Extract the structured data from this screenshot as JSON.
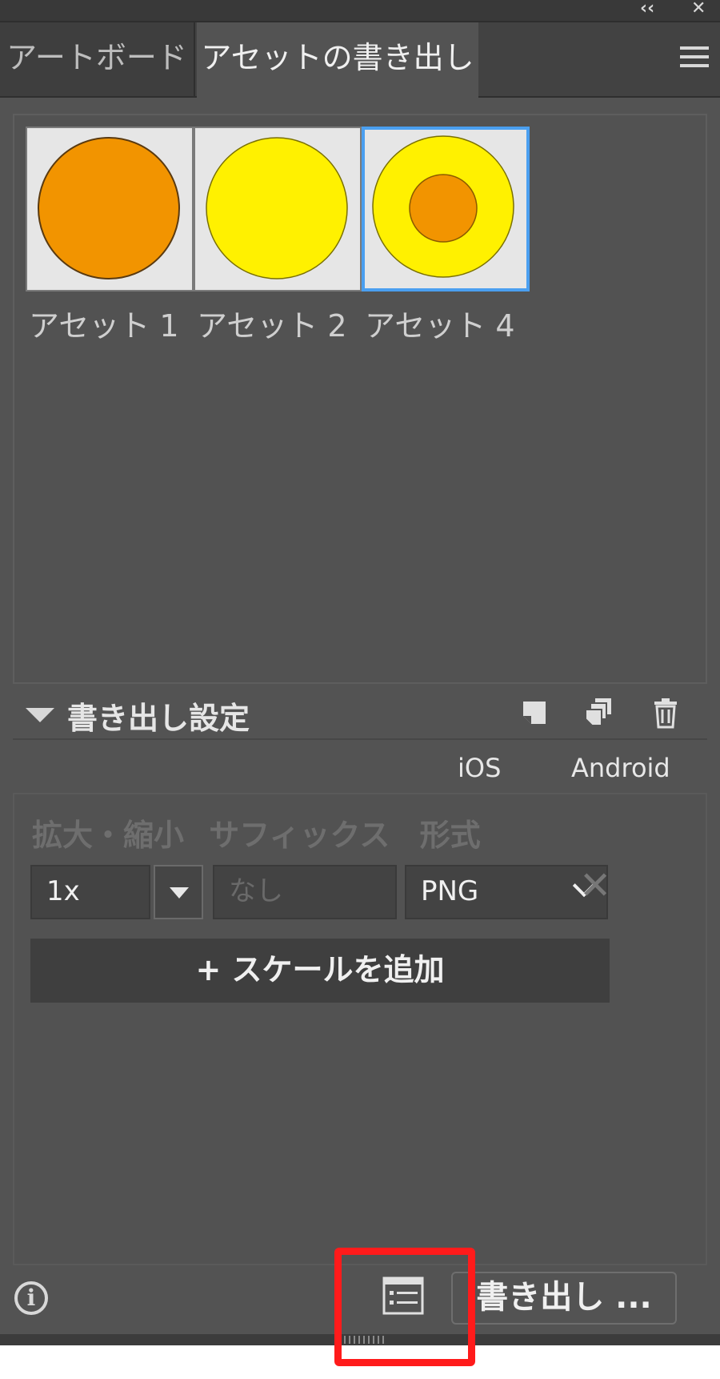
{
  "titlebar": {
    "collapse_glyph": "‹‹",
    "close_glyph": "✕"
  },
  "tabs": [
    {
      "label": "アートボード",
      "active": false
    },
    {
      "label": "アセットの書き出し",
      "active": true
    }
  ],
  "panel_menu_icon": "hamburger-menu-icon",
  "assets": [
    {
      "label": "アセット 1",
      "selected": false,
      "shape": "orange-circle"
    },
    {
      "label": "アセット 2",
      "selected": false,
      "shape": "yellow-circle"
    },
    {
      "label": "アセット 4",
      "selected": true,
      "shape": "yellow-circle-with-orange-center"
    }
  ],
  "export_settings": {
    "title": "書き出し設定",
    "icons": [
      "new-format-icon",
      "duplicate-format-icon",
      "trash-icon"
    ]
  },
  "presets": {
    "ios": "iOS",
    "android": "Android"
  },
  "columns": {
    "scale": "拡大・縮小",
    "suffix": "サフィックス",
    "format": "形式"
  },
  "scale_row": {
    "scale_value": "1x",
    "suffix_placeholder": "なし",
    "format_value": "PNG"
  },
  "add_scale_label": "+ スケールを追加",
  "footer": {
    "info_icon": "info-icon",
    "list_icon": "export-list-icon",
    "export_label": "書き出し ..."
  },
  "colors": {
    "panel_bg": "#535353",
    "selection_blue": "#4a9ff0",
    "orange": "#f29400",
    "yellow": "#fff100",
    "highlight_red": "#ff1b1b"
  }
}
